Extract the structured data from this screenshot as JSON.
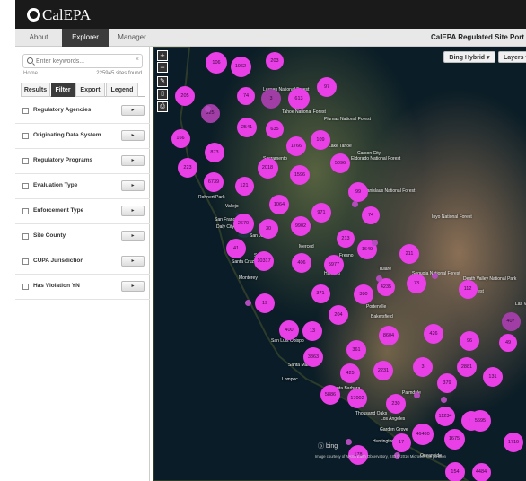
{
  "header": {
    "logo": "CalEPA"
  },
  "topnav": {
    "tabs": [
      {
        "label": "About",
        "active": false
      },
      {
        "label": "Explorer",
        "active": true
      },
      {
        "label": "Manager",
        "active": false
      }
    ],
    "app_title": "CalEPA Regulated Site Port"
  },
  "sidebar": {
    "search_placeholder": "Enter keywords...",
    "breadcrumb": "Home",
    "result_count": "225945 sites found",
    "tabs": [
      "Results",
      "Filter",
      "Export",
      "Legend"
    ],
    "active_tab": "Filter",
    "filters": [
      "Regulatory Agencies",
      "Originating Data System",
      "Regulatory Programs",
      "Evaluation Type",
      "Enforcement Type",
      "Site County",
      "CUPA Jurisdiction",
      "Has Violation YN"
    ]
  },
  "map": {
    "basemap_button": "Bing Hybrid",
    "layers_button": "Layers",
    "attribution_logo": "bing",
    "attribution": "Image courtesy of NASA Earth Observatory, SIO © 2016 Microsoft Corporation",
    "clusters": [
      "106",
      "1962",
      "203",
      "205",
      "74",
      "3",
      "613",
      "97",
      "325",
      "2541",
      "635",
      "1766",
      "109",
      "166",
      "873",
      "2018",
      "1596",
      "5096",
      "223",
      "6739",
      "121",
      "1064",
      "971",
      "99",
      "74",
      "2670",
      "30",
      "9902",
      "213",
      "1649",
      "211",
      "41",
      "10317",
      "406",
      "5977",
      "371",
      "380",
      "4235",
      "73",
      "112",
      "19",
      "204",
      "407",
      "13",
      "400",
      "361",
      "8604",
      "426",
      "96",
      "49",
      "3863",
      "425",
      "2231",
      "3",
      "2881",
      "5886",
      "17002",
      "230",
      "379",
      "131",
      "11234",
      "46",
      "5695",
      "46480",
      "1675",
      "178",
      "17",
      "1719",
      "154",
      "4484"
    ],
    "places": [
      "Lassen National Forest",
      "Plumas National Forest",
      "Tahoe National Forest",
      "Eldorado National Forest",
      "Sacramento",
      "Lake Tahoe",
      "Carson City",
      "Stanislaus National Forest",
      "Rohnert Park",
      "Vallejo",
      "San Francisco",
      "Daly City",
      "San Jose",
      "Santa Cruz",
      "Salinas",
      "Monterey",
      "Modesto",
      "Merced",
      "Fresno",
      "Tulare",
      "Hanford",
      "Porterville",
      "Bakersfield",
      "San Luis Obispo",
      "Santa Maria",
      "Lompoc",
      "Santa Barbara",
      "Thousand Oaks",
      "Los Angeles",
      "Garden Grove",
      "Huntington Beach",
      "Oceanside",
      "Palmdale",
      "Ridgecrest",
      "Sequoia National Forest",
      "Inyo National Forest",
      "Death Valley National Park",
      "Las Ve"
    ]
  }
}
